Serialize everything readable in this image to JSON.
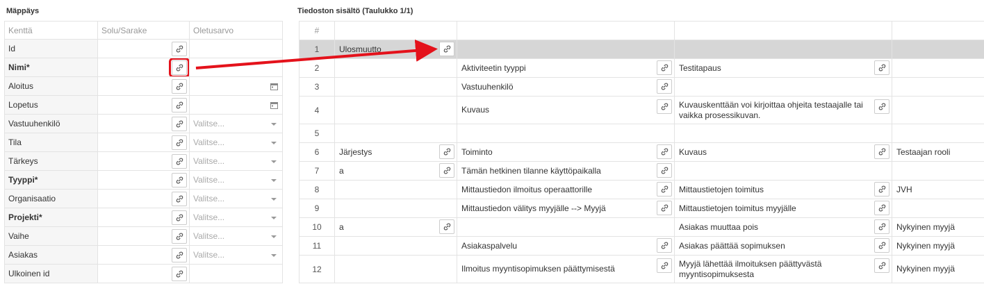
{
  "mapping": {
    "title": "Mäppäys",
    "headers": [
      "Kenttä",
      "Solu/Sarake",
      "Oletusarvo"
    ],
    "rows": [
      {
        "name": "Id",
        "required": false,
        "default_type": "none",
        "default_text": ""
      },
      {
        "name": "Nimi*",
        "required": true,
        "default_type": "none",
        "default_text": ""
      },
      {
        "name": "Aloitus",
        "required": false,
        "default_type": "date",
        "default_text": ""
      },
      {
        "name": "Lopetus",
        "required": false,
        "default_type": "date",
        "default_text": ""
      },
      {
        "name": "Vastuuhenkilö",
        "required": false,
        "default_type": "select",
        "default_text": "Valitse..."
      },
      {
        "name": "Tila",
        "required": false,
        "default_type": "select",
        "default_text": "Valitse..."
      },
      {
        "name": "Tärkeys",
        "required": false,
        "default_type": "select",
        "default_text": "Valitse..."
      },
      {
        "name": "Tyyppi*",
        "required": true,
        "default_type": "select",
        "default_text": "Valitse..."
      },
      {
        "name": "Organisaatio",
        "required": false,
        "default_type": "select",
        "default_text": "Valitse..."
      },
      {
        "name": "Projekti*",
        "required": true,
        "default_type": "select",
        "default_text": "Valitse..."
      },
      {
        "name": "Vaihe",
        "required": false,
        "default_type": "select",
        "default_text": "Valitse..."
      },
      {
        "name": "Asiakas",
        "required": false,
        "default_type": "select",
        "default_text": "Valitse..."
      },
      {
        "name": "Ulkoinen id",
        "required": false,
        "default_type": "none",
        "default_text": ""
      }
    ]
  },
  "file": {
    "title": "Tiedoston sisältö (Taulukko 1/1)",
    "header_label": "#",
    "rows": [
      {
        "n": "1",
        "cells": [
          "Ulosmuutto",
          "",
          "",
          ""
        ],
        "links": [
          true,
          false,
          false,
          false
        ],
        "selected": true
      },
      {
        "n": "2",
        "cells": [
          "",
          "Aktiviteetin tyyppi",
          "Testitapaus",
          ""
        ],
        "links": [
          false,
          true,
          true,
          false
        ]
      },
      {
        "n": "3",
        "cells": [
          "",
          "Vastuuhenkilö",
          "",
          ""
        ],
        "links": [
          false,
          true,
          false,
          false
        ]
      },
      {
        "n": "4",
        "cells": [
          "",
          "Kuvaus",
          "Kuvauskenttään voi kirjoittaa ohjeita testaajalle tai vaikka prosessikuvan.",
          ""
        ],
        "links": [
          false,
          true,
          true,
          false
        ],
        "tall": true
      },
      {
        "n": "5",
        "cells": [
          "",
          "",
          "",
          ""
        ],
        "links": [
          false,
          false,
          false,
          false
        ]
      },
      {
        "n": "6",
        "cells": [
          "Järjestys",
          "Toiminto",
          "Kuvaus",
          "Testaajan rooli"
        ],
        "links": [
          true,
          true,
          true,
          false
        ]
      },
      {
        "n": "7",
        "cells": [
          "a",
          "Tämän hetkinen tilanne käyttöpaikalla",
          "",
          ""
        ],
        "links": [
          true,
          true,
          false,
          false
        ]
      },
      {
        "n": "8",
        "cells": [
          "",
          "Mittaustiedon ilmoitus operaattorille",
          "Mittaustietojen toimitus",
          "JVH"
        ],
        "links": [
          false,
          true,
          true,
          false
        ]
      },
      {
        "n": "9",
        "cells": [
          "",
          "Mittaustiedon välitys myyjälle --> Myyjä",
          "Mittaustietojen toimitus myyjälle",
          ""
        ],
        "links": [
          false,
          true,
          true,
          false
        ]
      },
      {
        "n": "10",
        "cells": [
          "a",
          "",
          "Asiakas muuttaa pois",
          "Nykyinen myyjä"
        ],
        "links": [
          true,
          false,
          true,
          false
        ]
      },
      {
        "n": "11",
        "cells": [
          "",
          "Asiakaspalvelu",
          "Asiakas päättää sopimuksen",
          "Nykyinen myyjä"
        ],
        "links": [
          false,
          true,
          true,
          false
        ]
      },
      {
        "n": "12",
        "cells": [
          "",
          "Ilmoitus myyntisopimuksen päättymisestä",
          "Myyjä lähettää ilmoituksen päättyvästä myyntisopimuksesta",
          "Nykyinen myyjä"
        ],
        "links": [
          false,
          true,
          true,
          false
        ],
        "tall": true
      }
    ]
  },
  "colors": {
    "highlight": "#e4121b",
    "selected_row": "#d6d6d6",
    "border": "#e3e3e3"
  },
  "icons": {
    "link": "link-icon",
    "calendar": "calendar-icon",
    "dropdown": "chevron-down-icon"
  }
}
